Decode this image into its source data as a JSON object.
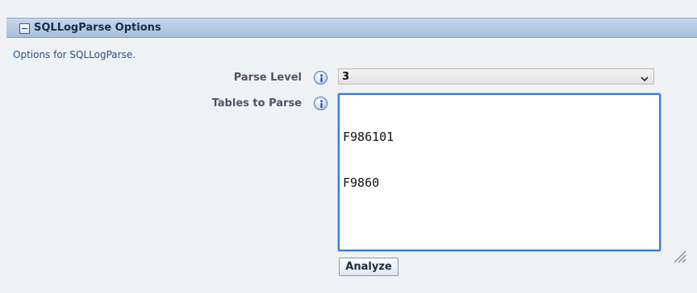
{
  "panel": {
    "title": "SQLLogParse Options",
    "description": "Options for SQLLogParse."
  },
  "fields": {
    "parse_level": {
      "label": "Parse Level",
      "value": "3"
    },
    "tables_to_parse": {
      "label": "Tables to Parse",
      "lines": [
        "F986101",
        "F9860"
      ]
    }
  },
  "actions": {
    "analyze_label": "Analyze"
  },
  "icons": {
    "collapse": "collapse-minus-icon",
    "info": "info-icon",
    "dropdown": "chevron-down-icon",
    "resize": "resize-grip-icon"
  },
  "colors": {
    "header_top": "#c6d6ea",
    "header_bottom": "#a9c0dd",
    "focus_border": "#3a7bd5",
    "description_text": "#254f87"
  }
}
